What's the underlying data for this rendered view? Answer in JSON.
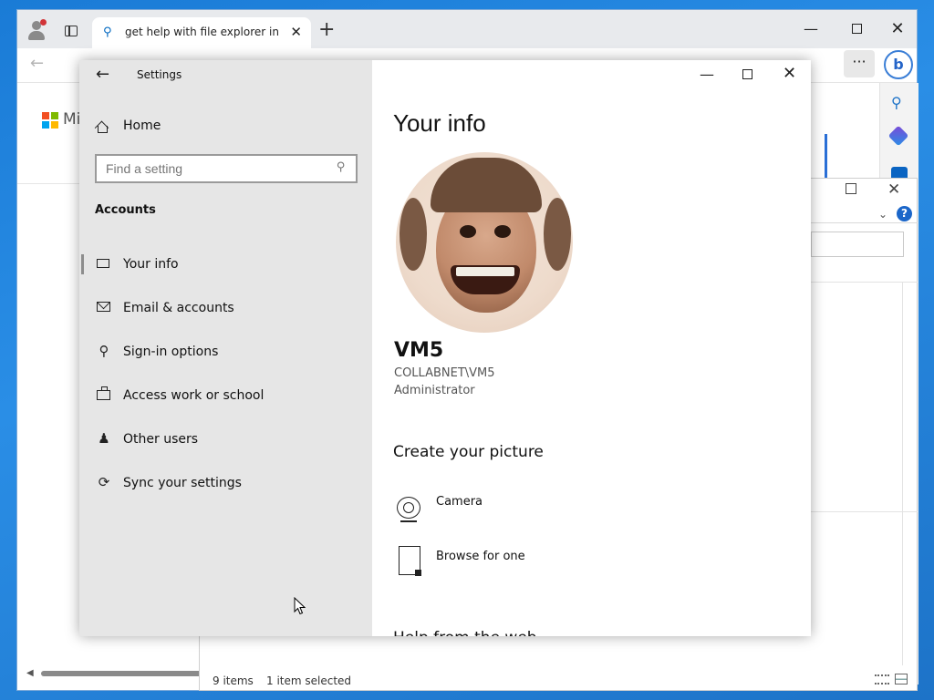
{
  "browser": {
    "tab_title": "get help with file explorer in windows",
    "brand_partial": "Mic"
  },
  "explorer": {
    "items_count": "9 items",
    "selected_count": "1 item selected"
  },
  "settings": {
    "app_title": "Settings",
    "nav_home": "Home",
    "search_placeholder": "Find a setting",
    "section_title": "Accounts",
    "nav_items": [
      {
        "label": "Your info",
        "icon": "person-card-icon",
        "active": true
      },
      {
        "label": "Email & accounts",
        "icon": "mail-icon",
        "active": false
      },
      {
        "label": "Sign-in options",
        "icon": "key-icon",
        "active": false
      },
      {
        "label": "Access work or school",
        "icon": "briefcase-icon",
        "active": false
      },
      {
        "label": "Other users",
        "icon": "add-user-icon",
        "active": false
      },
      {
        "label": "Sync your settings",
        "icon": "sync-icon",
        "active": false
      }
    ],
    "page_title": "Your info",
    "user": {
      "name": "VM5",
      "account": "COLLABNET\\VM5",
      "role": "Administrator"
    },
    "create_picture_title": "Create your picture",
    "picture_options": [
      {
        "label": "Camera",
        "icon": "camera-icon"
      },
      {
        "label": "Browse for one",
        "icon": "file-icon"
      }
    ],
    "cut_off_heading": "Help from the web"
  },
  "colors": {
    "desktop": "#1a7bd6",
    "settings_sidebar": "#e6e6e6",
    "accent": "#0067c0"
  }
}
